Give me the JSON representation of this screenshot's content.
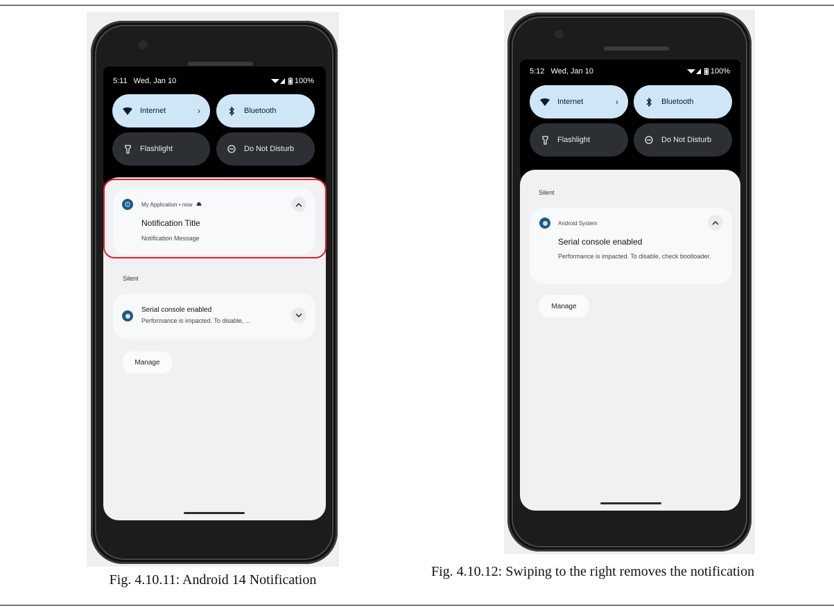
{
  "figures": [
    {
      "caption": "Fig. 4.10.11: Android 14 Notification",
      "status_time": "5:11",
      "status_date": "Wed, Jan 10",
      "battery": "100%",
      "tiles": [
        {
          "label": "Internet",
          "icon": "wifi-icon",
          "state": "on"
        },
        {
          "label": "Bluetooth",
          "icon": "bluetooth-icon",
          "state": "on"
        },
        {
          "label": "Flashlight",
          "icon": "flashlight-icon",
          "state": "off"
        },
        {
          "label": "Do Not Disturb",
          "icon": "do-not-disturb-icon",
          "state": "off"
        }
      ],
      "notification": {
        "app_name": "My Application",
        "when": "now",
        "title": "Notification Title",
        "message": "Notification Message"
      },
      "silent_label": "Silent",
      "silent_notification": {
        "title": "Serial console enabled",
        "message": "Performance is impacted. To disable, ..."
      },
      "manage_label": "Manage"
    },
    {
      "caption": "Fig. 4.10.12: Swiping to the right removes the notification",
      "status_time": "5:12",
      "status_date": "Wed, Jan 10",
      "battery": "100%",
      "tiles": [
        {
          "label": "Internet",
          "icon": "wifi-icon",
          "state": "on"
        },
        {
          "label": "Bluetooth",
          "icon": "bluetooth-icon",
          "state": "on"
        },
        {
          "label": "Flashlight",
          "icon": "flashlight-icon",
          "state": "off"
        },
        {
          "label": "Do Not Disturb",
          "icon": "do-not-disturb-icon",
          "state": "off"
        }
      ],
      "silent_label": "Silent",
      "system_notification": {
        "app_name": "Android System",
        "title": "Serial console enabled",
        "message": "Performance is impacted. To disable, check bootloader."
      },
      "manage_label": "Manage"
    }
  ],
  "colors": {
    "tile_on": "#cfe6f7",
    "tile_off": "#2c2f33",
    "highlight": "#e0202a",
    "app_icon": "#1d5a85"
  }
}
